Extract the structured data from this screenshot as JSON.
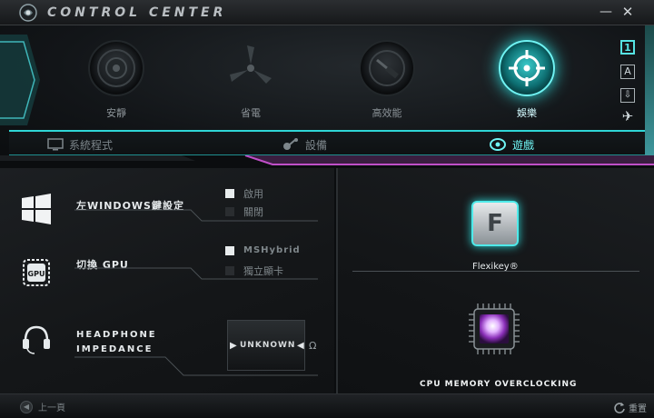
{
  "app": {
    "title": "CONTROL CENTER"
  },
  "window": {
    "minimize": "—",
    "close": "✕"
  },
  "modes": [
    {
      "id": "quiet",
      "label": "安靜",
      "active": false
    },
    {
      "id": "power_saving",
      "label": "省電",
      "active": false
    },
    {
      "id": "performance",
      "label": "高效能",
      "active": false
    },
    {
      "id": "entertainment",
      "label": "娛樂",
      "active": true
    }
  ],
  "side_icons": {
    "profile": "1",
    "font": "A",
    "download": "⇩",
    "plane": "✈"
  },
  "tabs": [
    {
      "id": "system",
      "label": "系統程式",
      "icon": "monitor-icon",
      "active": false
    },
    {
      "id": "device",
      "label": "設備",
      "icon": "device-icon",
      "active": false
    },
    {
      "id": "game",
      "label": "遊戲",
      "icon": "eye-icon",
      "active": true
    }
  ],
  "settings": {
    "windows_key": {
      "label": "左WINDOWS鍵設定",
      "options": [
        {
          "label": "啟用",
          "checked": true
        },
        {
          "label": "關閉",
          "checked": false
        }
      ]
    },
    "gpu": {
      "label": "切換 GPU",
      "options": [
        {
          "label": "MSHybrid",
          "checked": true
        },
        {
          "label": "獨立顯卡",
          "checked": false
        }
      ]
    },
    "headphone": {
      "label_line1": "HEADPHONE",
      "label_line2": "IMPEDANCE",
      "value": "UNKNOWN",
      "unit": "Ω"
    }
  },
  "right": {
    "flexikey": {
      "key": "F",
      "label": "Flexikey®"
    },
    "overclock": {
      "label": "CPU MEMORY OVERCLOCKING"
    }
  },
  "bottom": {
    "back_label": "上一頁",
    "reset_label": "重置"
  },
  "colors": {
    "accent": "#2fd6d6",
    "magenta": "#c04fc8"
  }
}
